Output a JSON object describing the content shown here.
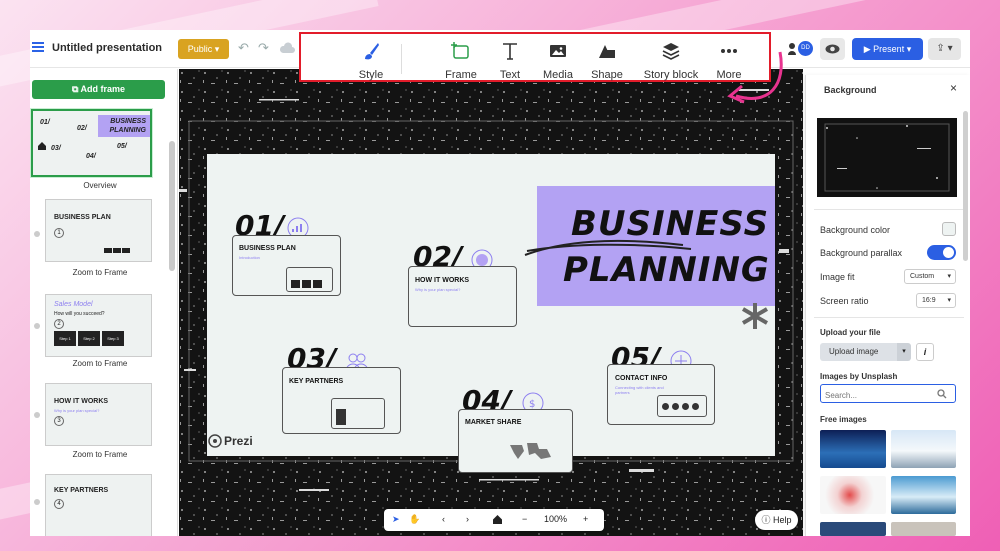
{
  "app": {
    "title": "Untitled presentation",
    "visibility": "Public",
    "present_label": "Present",
    "collab_initials": "DD"
  },
  "toolbar": {
    "items": [
      {
        "label": "Style",
        "icon": "brush-icon"
      },
      {
        "label": "Frame",
        "icon": "frame-plus-icon"
      },
      {
        "label": "Text",
        "icon": "text-icon"
      },
      {
        "label": "Media",
        "icon": "image-icon"
      },
      {
        "label": "Shape",
        "icon": "shape-icon"
      },
      {
        "label": "Story block",
        "icon": "layers-icon"
      },
      {
        "label": "More",
        "icon": "more-dots-icon"
      }
    ]
  },
  "sidebar": {
    "add_frame_label": "Add frame",
    "items": [
      {
        "caption": "Overview"
      },
      {
        "caption": "Zoom to Frame",
        "number": "1",
        "title": "BUSINESS PLAN"
      },
      {
        "caption": "Zoom to Frame",
        "number": "2",
        "title": "Sales Model",
        "subtitle": "How will you succeed?",
        "steps": [
          "Step 1",
          "Step 2",
          "Step 3"
        ]
      },
      {
        "caption": "Zoom to Frame",
        "number": "3",
        "title": "HOW IT WORKS",
        "subtitle": "Why is your plan special?"
      },
      {
        "caption": "",
        "number": "4",
        "title": "KEY PARTNERS"
      }
    ]
  },
  "slide": {
    "title_line1": "BUSINESS",
    "title_line2": "PLANNING",
    "brand": "Prezi",
    "sections": [
      {
        "num": "01/",
        "title": "BUSINESS PLAN",
        "sub": "Introduction"
      },
      {
        "num": "02/",
        "title": "HOW IT WORKS",
        "sub": "Why is your plan special?"
      },
      {
        "num": "03/",
        "title": "KEY PARTNERS",
        "sub": ""
      },
      {
        "num": "04/",
        "title": "MARKET SHARE",
        "sub": ""
      },
      {
        "num": "05/",
        "title": "CONTACT INFO",
        "sub": "Connecting with clients and partners"
      }
    ]
  },
  "bottom_controls": {
    "zoom": "100%",
    "help": "Help"
  },
  "right_panel": {
    "title": "Background",
    "background_color_label": "Background color",
    "background_parallax_label": "Background parallax",
    "background_parallax_on": true,
    "image_fit_label": "Image fit",
    "image_fit_value": "Custom",
    "screen_ratio_label": "Screen ratio",
    "screen_ratio_value": "16:9",
    "upload_heading": "Upload your file",
    "upload_button": "Upload image",
    "unsplash_heading": "Images by Unsplash",
    "search_placeholder": "Search...",
    "free_images_heading": "Free images"
  },
  "colors": {
    "accent_blue": "#2b5fe3",
    "add_frame_green": "#2b9d4a",
    "public_gold": "#d9a321",
    "title_purple": "#b3a2f3",
    "highlight_red": "#e21c2a",
    "arrow_pink": "#e8338f"
  }
}
